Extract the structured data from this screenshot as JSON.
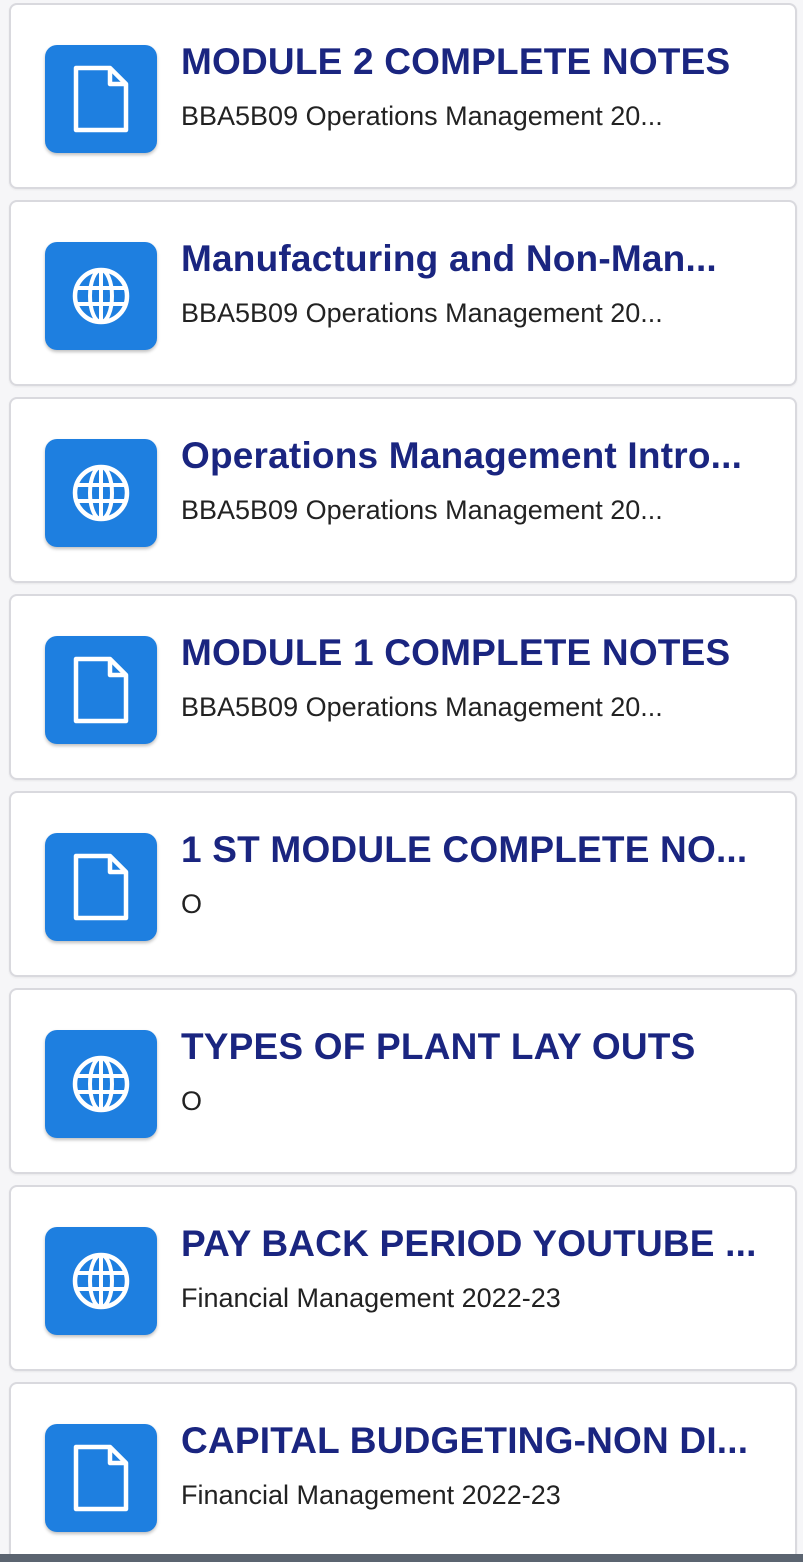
{
  "items": [
    {
      "icon": "document-icon",
      "title": "MODULE 2 COMPLETE NOTES",
      "subtitle": "BBA5B09 Operations Management 20..."
    },
    {
      "icon": "globe-icon",
      "title": "Manufacturing and Non-Man...",
      "subtitle": "BBA5B09 Operations Management 20..."
    },
    {
      "icon": "globe-icon",
      "title": "Operations Management Intro...",
      "subtitle": "BBA5B09 Operations Management 20..."
    },
    {
      "icon": "document-icon",
      "title": "MODULE 1 COMPLETE NOTES",
      "subtitle": "BBA5B09 Operations Management 20..."
    },
    {
      "icon": "document-icon",
      "title": "1 ST MODULE COMPLETE NO...",
      "subtitle": "O"
    },
    {
      "icon": "globe-icon",
      "title": "TYPES OF PLANT LAY OUTS",
      "subtitle": "O"
    },
    {
      "icon": "globe-icon",
      "title": "PAY BACK PERIOD YOUTUBE ...",
      "subtitle": "Financial Management 2022-23"
    },
    {
      "icon": "document-icon",
      "title": "CAPITAL BUDGETING-NON DI...",
      "subtitle": "Financial Management 2022-23"
    }
  ],
  "colors": {
    "icon_background": "#1e7fe0",
    "title": "#1a2580",
    "subtitle": "#222222"
  }
}
